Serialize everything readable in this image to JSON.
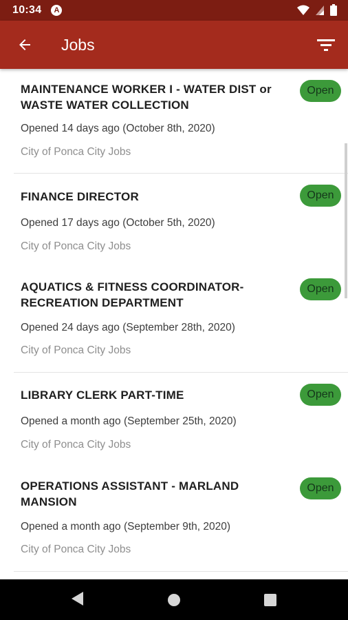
{
  "status_bar": {
    "time": "10:34",
    "app_icon_letter": "A"
  },
  "app_bar": {
    "title": "Jobs",
    "back_icon": "arrow-left-icon",
    "filter_icon": "filter-icon"
  },
  "jobs": [
    {
      "title": "MAINTENANCE WORKER I - WATER DIST or WASTE WATER COLLECTION",
      "opened": "Opened 14 days ago (October 8th, 2020)",
      "source": "City of Ponca City Jobs",
      "status": "Open"
    },
    {
      "title": "FINANCE DIRECTOR",
      "opened": "Opened 17 days ago (October 5th, 2020)",
      "source": "City of Ponca City Jobs",
      "status": "Open"
    },
    {
      "title": "AQUATICS & FITNESS COORDINATOR- RECREATION DEPARTMENT",
      "opened": "Opened 24 days ago (September 28th, 2020)",
      "source": "City of Ponca City Jobs",
      "status": "Open"
    },
    {
      "title": "LIBRARY CLERK PART-TIME",
      "opened": "Opened a month ago (September 25th, 2020)",
      "source": "City of Ponca City Jobs",
      "status": "Open"
    },
    {
      "title": "OPERATIONS ASSISTANT - MARLAND MANSION",
      "opened": "Opened a month ago (September 9th, 2020)",
      "source": "City of Ponca City Jobs",
      "status": "Open"
    }
  ],
  "colors": {
    "app_bar": "#a42b1d",
    "status_bar": "#7c1d12",
    "open_badge": "#3c9a3a"
  }
}
